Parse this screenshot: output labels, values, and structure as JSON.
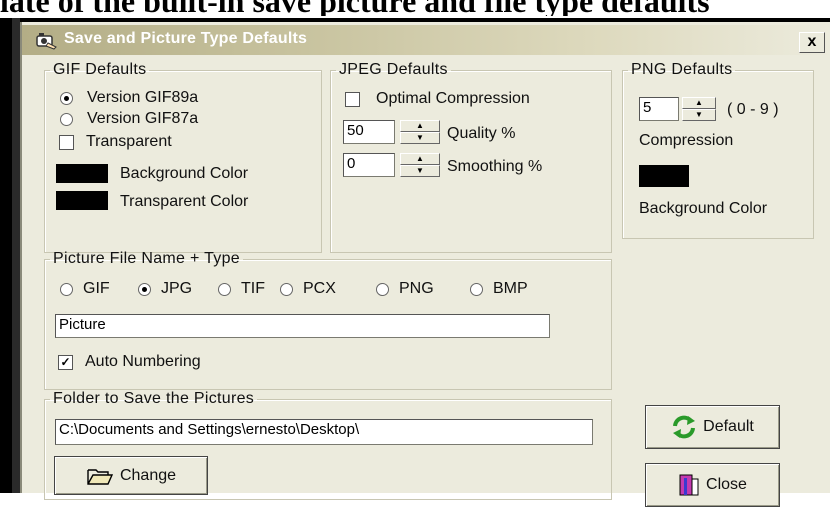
{
  "top_text": "late of the built-in save picture and file type defaults",
  "window": {
    "title": "Save and Picture Type Defaults",
    "close_label": "x"
  },
  "gif": {
    "legend": "GIF Defaults",
    "version_89a": "Version GIF89a",
    "version_87a": "Version GIF87a",
    "transparent": "Transparent",
    "background_color": "Background Color",
    "transparent_color": "Transparent Color",
    "selected_version": "GIF89a",
    "transparent_checked": false,
    "background_color_value": "#000000",
    "transparent_color_value": "#000000"
  },
  "jpeg": {
    "legend": "JPEG Defaults",
    "optimal_compression": "Optimal Compression",
    "optimal_checked": false,
    "quality_value": "50",
    "quality_label": "Quality %",
    "smoothing_value": "0",
    "smoothing_label": "Smoothing %"
  },
  "png": {
    "legend": "PNG Defaults",
    "compression_value": "5",
    "range_label": "( 0 - 9 )",
    "compression_label": "Compression",
    "background_color": "Background Color",
    "background_color_value": "#000000"
  },
  "picture_file": {
    "legend": "Picture File Name + Type",
    "types": [
      "GIF",
      "JPG",
      "TIF",
      "PCX",
      "PNG",
      "BMP"
    ],
    "selected_type": "JPG",
    "name_value": "Picture",
    "auto_numbering": "Auto Numbering",
    "auto_numbering_checked": true
  },
  "folder": {
    "legend": "Folder to Save the Pictures",
    "path_value": "C:\\Documents and Settings\\ernesto\\Desktop\\",
    "change_label": "Change"
  },
  "buttons": {
    "default_label": "Default",
    "close_label": "Close"
  }
}
